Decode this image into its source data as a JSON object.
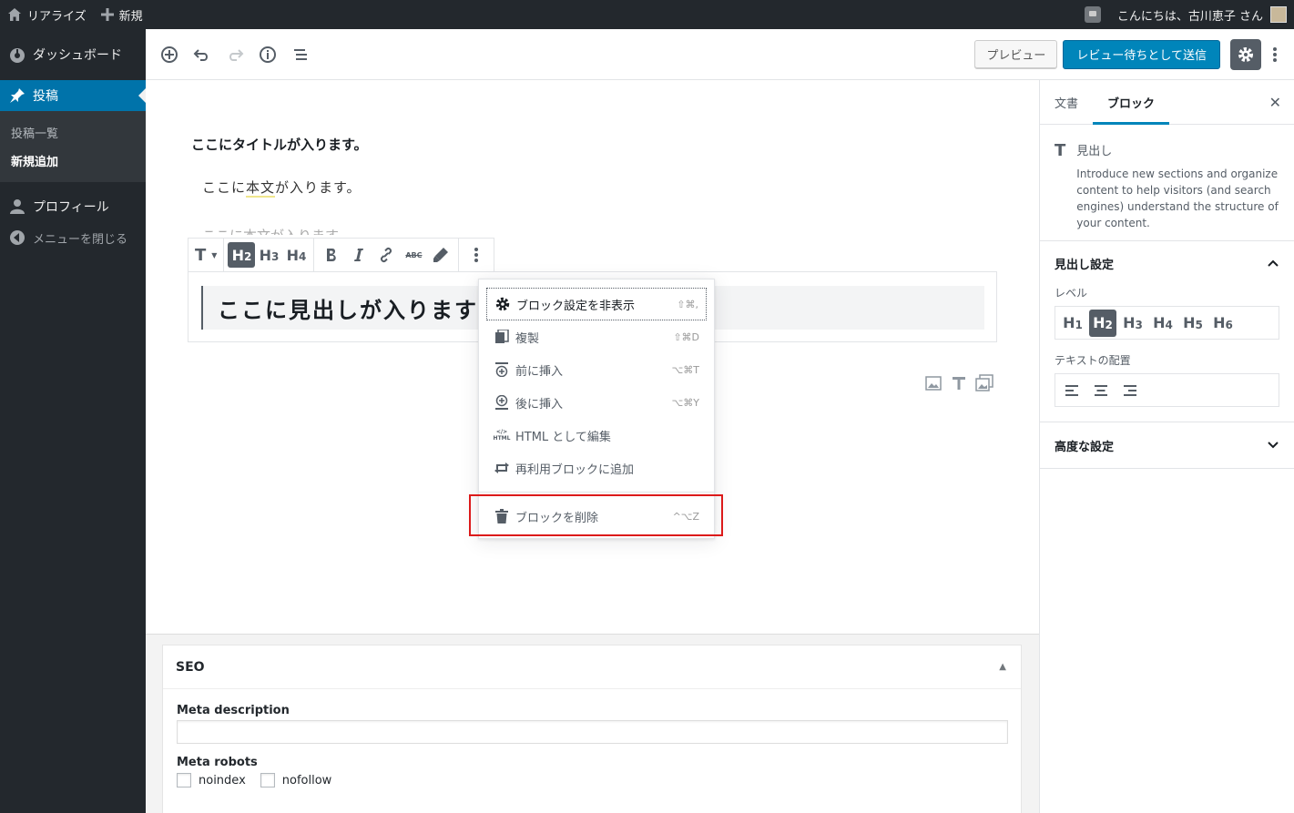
{
  "adminbar": {
    "site_name": "リアライズ",
    "new_label": "新規",
    "greeting": "こんにちは、古川恵子 さん"
  },
  "sidebar": {
    "dashboard": "ダッシュボード",
    "posts": "投稿",
    "posts_list": "投稿一覧",
    "add_new": "新規追加",
    "profile": "プロフィール",
    "collapse": "メニューを閉じる"
  },
  "header": {
    "preview": "プレビュー",
    "submit": "レビュー待ちとして送信"
  },
  "editor": {
    "title": "ここにタイトルが入ります。",
    "para_before": "ここに",
    "para_highlight": "本文",
    "para_after": "が入ります。",
    "para2": "ここに本文が入ります",
    "heading": "ここに見出しが入ります",
    "toolbar": {
      "h2": "H",
      "h2_sub": "2",
      "h3": "H",
      "h3_sub": "3",
      "h4": "H",
      "h4_sub": "4"
    }
  },
  "dropdown": {
    "items": [
      {
        "label": "ブロック設定を非表示",
        "shortcut": "⇧⌘,",
        "icon": "gear-icon"
      },
      {
        "label": "複製",
        "shortcut": "⇧⌘D",
        "icon": "duplicate-icon"
      },
      {
        "label": "前に挿入",
        "shortcut": "⌥⌘T",
        "icon": "insert-before-icon"
      },
      {
        "label": "後に挿入",
        "shortcut": "⌥⌘Y",
        "icon": "insert-after-icon"
      },
      {
        "label": "HTML として編集",
        "shortcut": "",
        "icon": "html-icon"
      },
      {
        "label": "再利用ブロックに追加",
        "shortcut": "",
        "icon": "reusable-icon"
      },
      {
        "label": "ブロックを削除",
        "shortcut": "^⌥Z",
        "icon": "trash-icon"
      }
    ],
    "highlight_color": "#dc1a1a"
  },
  "seo": {
    "title": "SEO",
    "meta_description_label": "Meta description",
    "meta_description_value": "",
    "meta_robots_label": "Meta robots",
    "noindex": "noindex",
    "nofollow": "nofollow"
  },
  "rsidebar": {
    "tab_document": "文書",
    "tab_block": "ブロック",
    "block_name": "見出し",
    "block_desc": "Introduce new sections and organize content to help visitors (and search engines) understand the structure of your content.",
    "heading_settings": "見出し設定",
    "level_label": "レベル",
    "levels": [
      "H",
      "H",
      "H",
      "H",
      "H",
      "H"
    ],
    "level_nums": [
      "1",
      "2",
      "3",
      "4",
      "5",
      "6"
    ],
    "text_align_label": "テキストの配置",
    "advanced": "高度な設定"
  },
  "colors": {
    "admin_dark": "#23282d",
    "accent": "#0073aa",
    "primary_button": "#0085ba"
  }
}
